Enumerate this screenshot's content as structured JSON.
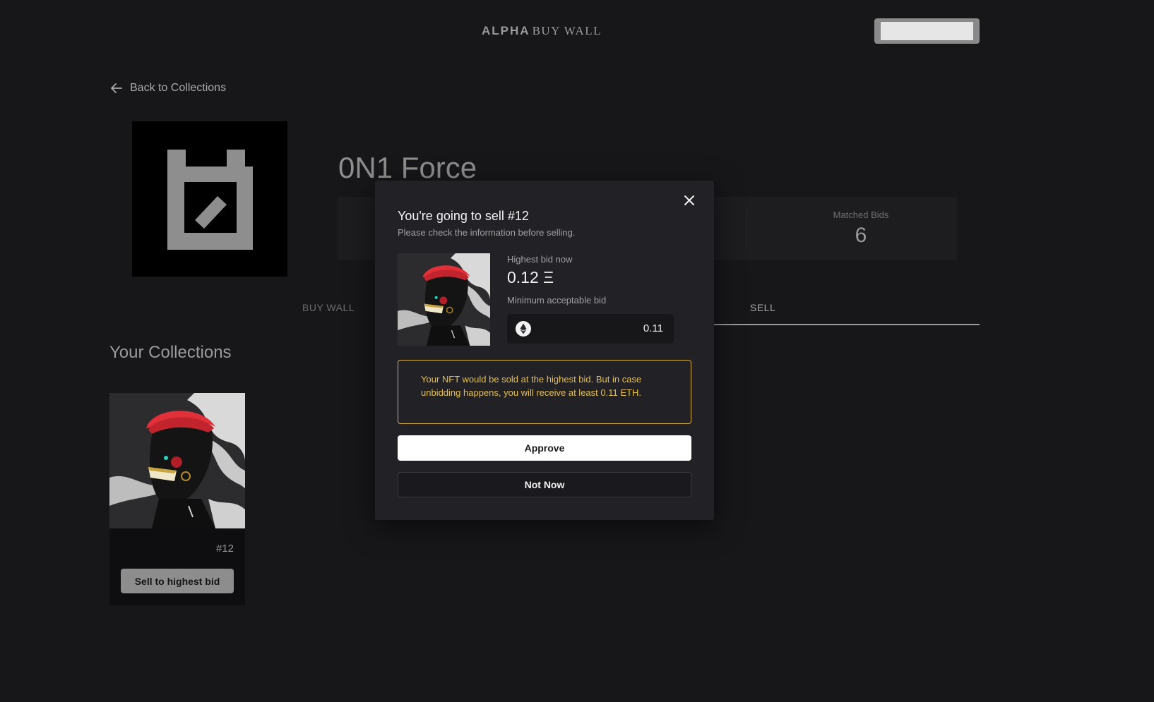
{
  "header": {
    "brand_primary": "ALPHA",
    "brand_secondary": "BUY WALL"
  },
  "nav": {
    "back_label": "Back to Collections"
  },
  "collection": {
    "title": "0N1 Force",
    "stats": {
      "matched_bids_label": "Matched Bids",
      "matched_bids_value": "6"
    },
    "tabs": [
      {
        "label": "BUY WALL",
        "active": false
      },
      {
        "label": "SELL",
        "active": true
      }
    ]
  },
  "your_collections": {
    "title": "Your Collections",
    "items": [
      {
        "id_label": "#12",
        "button_label": "Sell to highest bid"
      }
    ]
  },
  "modal": {
    "title": "You're going to sell #12",
    "subtitle": "Please check the information before selling.",
    "highest_bid_label": "Highest bid now",
    "highest_bid_value": "0.12 Ξ",
    "min_bid_label": "Minimum acceptable bid",
    "min_bid_value": "0.11",
    "warning_text": "Your NFT would be sold at the highest bid. But in case unbidding happens, you will receive at least 0.11 ETH.",
    "approve_label": "Approve",
    "not_now_label": "Not Now"
  },
  "icons": {
    "back": "arrow-left-icon",
    "close": "close-icon",
    "currency": "ethereum-icon"
  },
  "colors": {
    "background": "#17171a",
    "modal": "#212126",
    "warning": "#e6bf4f",
    "nft_hair": "#e0303a"
  }
}
